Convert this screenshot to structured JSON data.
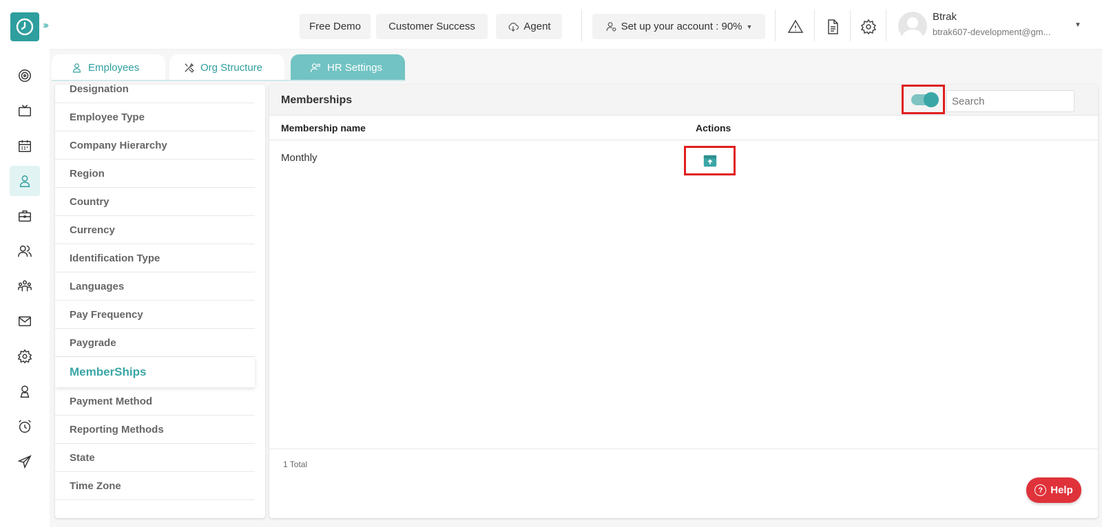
{
  "topbar": {
    "free_demo": "Free Demo",
    "customer_success": "Customer Success",
    "agent": "Agent",
    "setup": "Set up your account : 90%",
    "user_name": "Btrak",
    "user_email": "btrak607-development@gm..."
  },
  "tabs": [
    {
      "label": "Employees",
      "icon": "user-icon"
    },
    {
      "label": "Org Structure",
      "icon": "tools-icon"
    },
    {
      "label": "HR Settings",
      "icon": "users-cog-icon"
    }
  ],
  "settings_menu": [
    {
      "label": "Designation"
    },
    {
      "label": "Employee Type"
    },
    {
      "label": "Company Hierarchy"
    },
    {
      "label": "Region"
    },
    {
      "label": "Country"
    },
    {
      "label": "Currency"
    },
    {
      "label": "Identification Type"
    },
    {
      "label": "Languages"
    },
    {
      "label": "Pay Frequency"
    },
    {
      "label": "Paygrade"
    },
    {
      "label": "MemberShips",
      "active": true
    },
    {
      "label": "Payment Method"
    },
    {
      "label": "Reporting Methods"
    },
    {
      "label": "State"
    },
    {
      "label": "Time Zone"
    }
  ],
  "panel": {
    "title": "Memberships",
    "search_placeholder": "Search",
    "columns": [
      "Membership name",
      "Actions"
    ],
    "rows": [
      {
        "name": "Monthly"
      }
    ],
    "total": "1 Total"
  },
  "help": "Help",
  "colors": {
    "accent": "#2f9e9e",
    "highlight": "#e01e1e",
    "help": "#e0323a"
  }
}
